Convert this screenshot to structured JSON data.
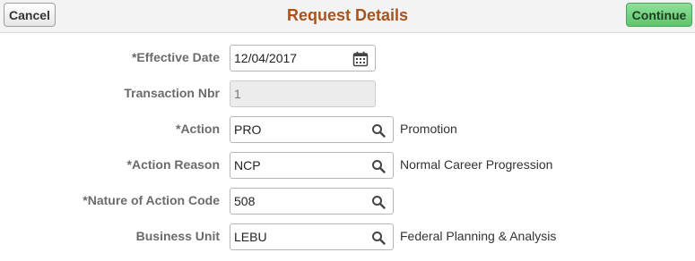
{
  "header": {
    "cancel_label": "Cancel",
    "title": "Request Details",
    "continue_label": "Continue"
  },
  "fields": {
    "effective_date": {
      "label": "*Effective Date",
      "value": "12/04/2017"
    },
    "transaction_nbr": {
      "label": "Transaction Nbr",
      "value": "1"
    },
    "action": {
      "label": "*Action",
      "value": "PRO",
      "description": "Promotion"
    },
    "action_reason": {
      "label": "*Action Reason",
      "value": "NCP",
      "description": "Normal Career Progression"
    },
    "nature_of_action_code": {
      "label": "*Nature of Action Code",
      "value": "508"
    },
    "business_unit": {
      "label": "Business Unit",
      "value": "LEBU",
      "description": "Federal Planning & Analysis"
    }
  },
  "icons": {
    "calendar": "calendar-icon",
    "lookup": "search-icon"
  },
  "colors": {
    "title": "#a9521b",
    "continue_button": "#5fc46e",
    "label": "#6b6b6b"
  }
}
